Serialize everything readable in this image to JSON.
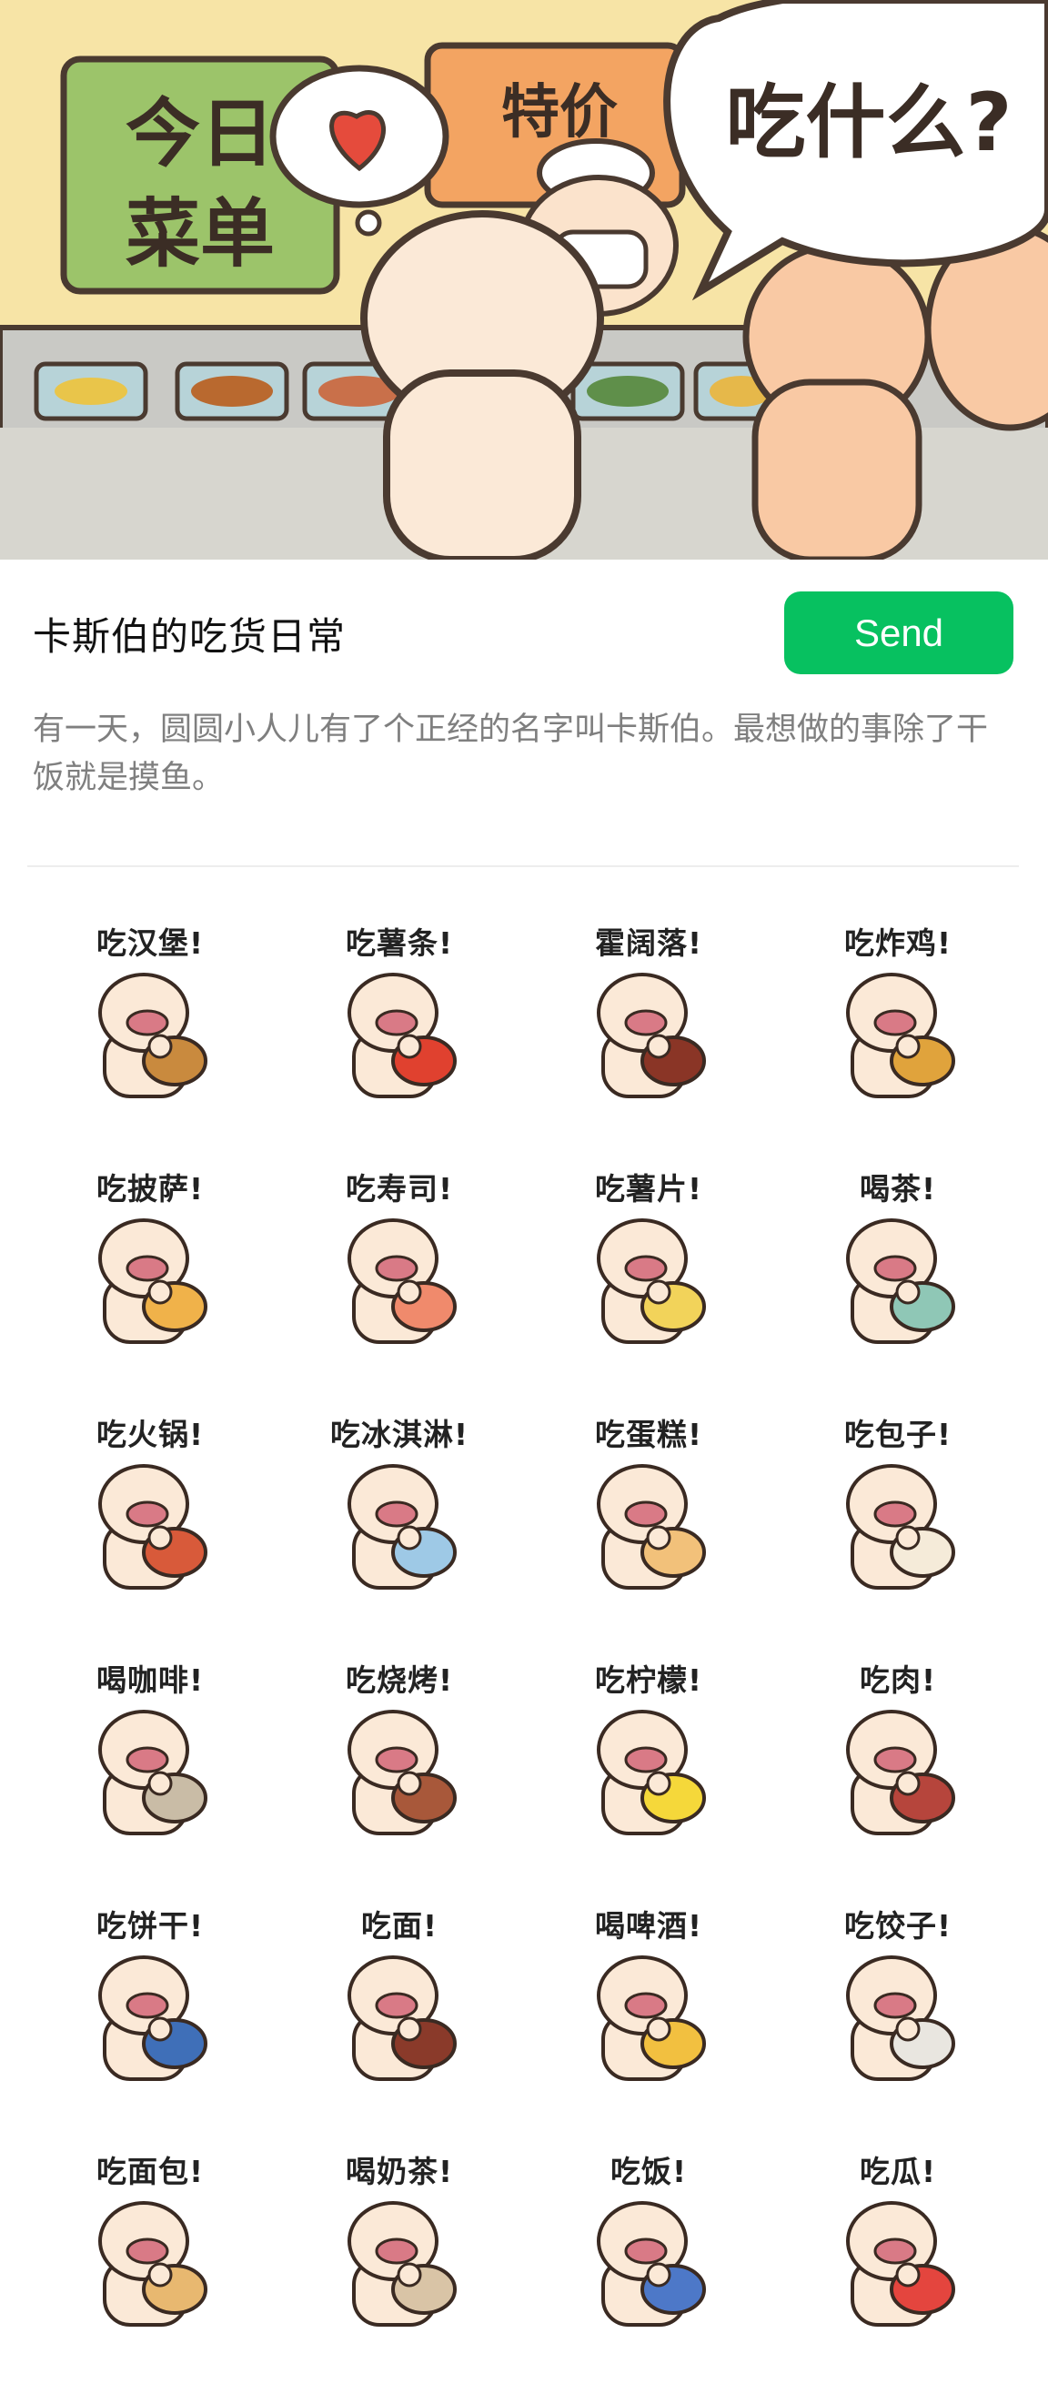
{
  "banner": {
    "menu_line1": "今日",
    "menu_line2": "菜单",
    "special": "特价",
    "bubble": "吃什么?"
  },
  "header": {
    "title": "卡斯伯的吃货日常",
    "send_label": "Send"
  },
  "description": "有一天，圆圆小人儿有了个正经的名字叫卡斯伯。最想做的事除了干饭就是摸鱼。",
  "stickers": [
    {
      "caption": "吃汉堡!",
      "prop": "burger",
      "color": "#c98a3e"
    },
    {
      "caption": "吃薯条!",
      "prop": "fries",
      "color": "#e0412f"
    },
    {
      "caption": "霍阔落!",
      "prop": "cola",
      "color": "#8a3526"
    },
    {
      "caption": "吃炸鸡!",
      "prop": "chicken",
      "color": "#e0a33c"
    },
    {
      "caption": "吃披萨!",
      "prop": "pizza",
      "color": "#f0b24a"
    },
    {
      "caption": "吃寿司!",
      "prop": "sushi",
      "color": "#f08a6c"
    },
    {
      "caption": "吃薯片!",
      "prop": "chips",
      "color": "#f2d35a"
    },
    {
      "caption": "喝茶!",
      "prop": "tea",
      "color": "#8fc7b6"
    },
    {
      "caption": "吃火锅!",
      "prop": "hotpot",
      "color": "#d85a3a"
    },
    {
      "caption": "吃冰淇淋!",
      "prop": "icecream",
      "color": "#9ec9e6"
    },
    {
      "caption": "吃蛋糕!",
      "prop": "cake",
      "color": "#f2c17a"
    },
    {
      "caption": "吃包子!",
      "prop": "bun",
      "color": "#f5ebd9"
    },
    {
      "caption": "喝咖啡!",
      "prop": "coffee",
      "color": "#c9bca6"
    },
    {
      "caption": "吃烧烤!",
      "prop": "bbq",
      "color": "#a8583a"
    },
    {
      "caption": "吃柠檬!",
      "prop": "lemon",
      "color": "#f5d83a"
    },
    {
      "caption": "吃肉!",
      "prop": "meat",
      "color": "#b6453c"
    },
    {
      "caption": "吃饼干!",
      "prop": "cookies",
      "color": "#3f6fb8"
    },
    {
      "caption": "吃面!",
      "prop": "noodles",
      "color": "#8a3a2a"
    },
    {
      "caption": "喝啤酒!",
      "prop": "beer",
      "color": "#f2c040"
    },
    {
      "caption": "吃饺子!",
      "prop": "dumplings",
      "color": "#e9e6e0"
    },
    {
      "caption": "吃面包!",
      "prop": "bread",
      "color": "#e8b870"
    },
    {
      "caption": "喝奶茶!",
      "prop": "milktea",
      "color": "#d9c4a6"
    },
    {
      "caption": "吃饭!",
      "prop": "rice",
      "color": "#4d78c8"
    },
    {
      "caption": "吃瓜!",
      "prop": "watermelon",
      "color": "#e4453e"
    }
  ],
  "colors": {
    "send_button": "#07c160",
    "description_text": "#7f7f7f",
    "character_skin": "#fbe9d7",
    "character_mouth": "#d97a86",
    "banner_bg": "#f7e4a6",
    "menu_board": "#9cc46a",
    "special_board": "#f3a462"
  }
}
